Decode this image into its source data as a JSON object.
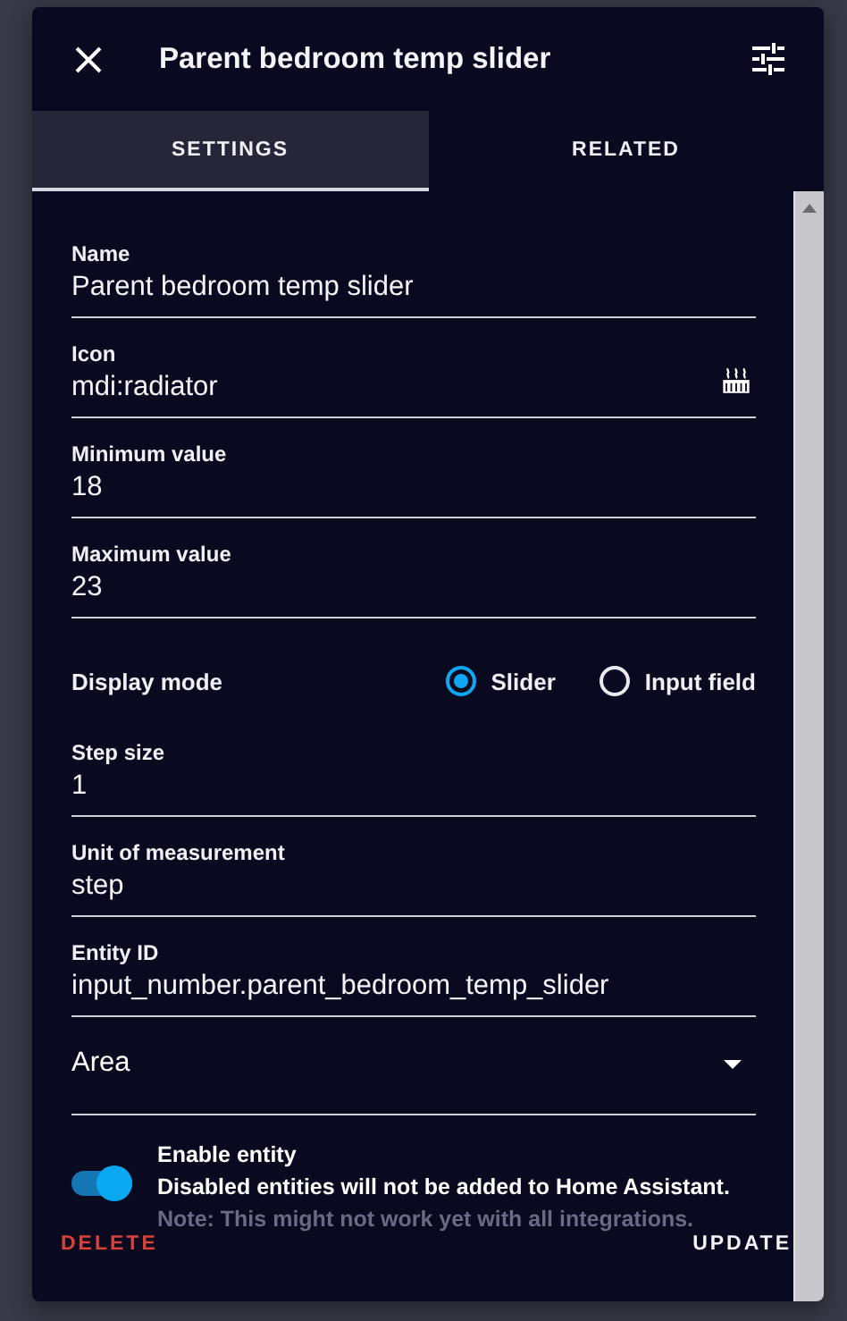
{
  "dialog": {
    "title": "Parent bedroom temp slider"
  },
  "tabs": [
    {
      "label": "SETTINGS",
      "selected": true
    },
    {
      "label": "RELATED",
      "selected": false
    }
  ],
  "fields": [
    {
      "kind": "text",
      "label": "Name",
      "value": "Parent bedroom temp slider"
    },
    {
      "kind": "icon",
      "label": "Icon",
      "value": "mdi:radiator"
    },
    {
      "kind": "text",
      "label": "Minimum value",
      "value": "18"
    },
    {
      "kind": "text",
      "label": "Maximum value",
      "value": "23"
    },
    {
      "kind": "radio",
      "label": "Display mode",
      "options": [
        {
          "label": "Slider",
          "selected": true
        },
        {
          "label": "Input field",
          "selected": false
        }
      ]
    },
    {
      "kind": "text",
      "label": "Step size",
      "value": "1"
    },
    {
      "kind": "text",
      "label": "Unit of measurement",
      "value": "step"
    },
    {
      "kind": "text",
      "label": "Entity ID",
      "value": "input_number.parent_bedroom_temp_slider"
    },
    {
      "kind": "select",
      "label": "Area"
    }
  ],
  "enable": {
    "on": true,
    "title": "Enable entity",
    "description": "Disabled entities will not be added to Home Assistant.",
    "note": "Note: This might not work yet with all integrations."
  },
  "footer": {
    "delete": "DELETE",
    "update": "UPDATE"
  }
}
